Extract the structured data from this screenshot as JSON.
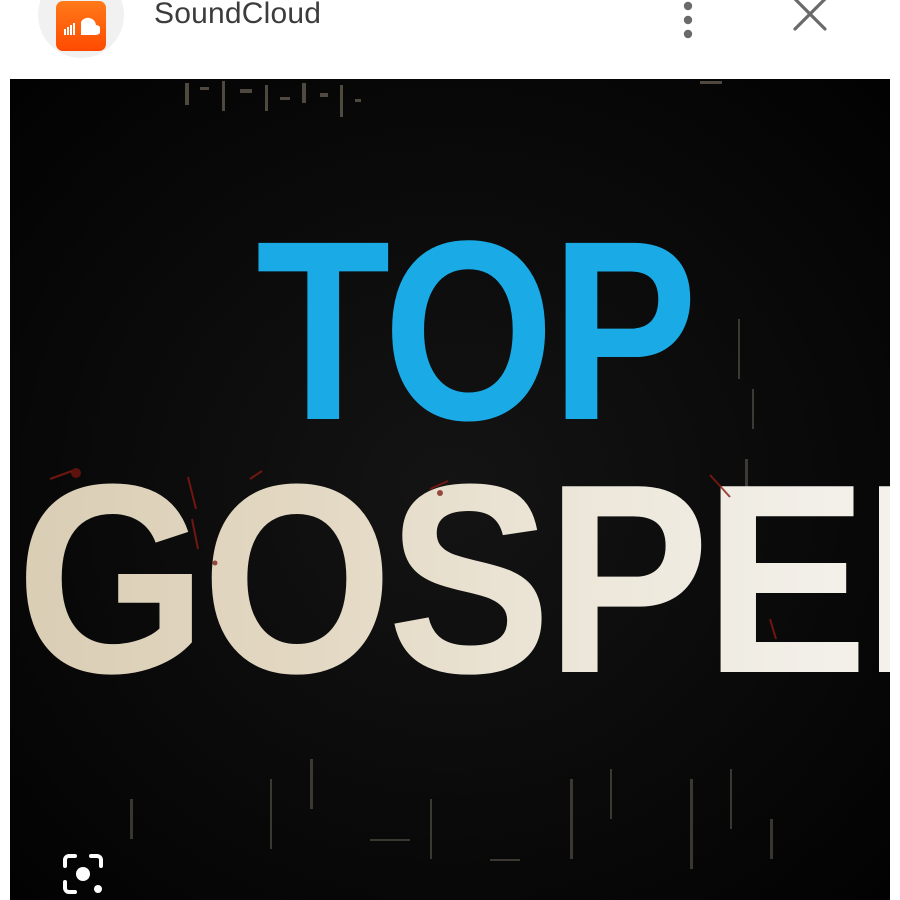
{
  "header": {
    "app_name": "SoundCloud",
    "app_icon": "soundcloud-logo-icon",
    "menu_icon": "more-vertical-icon",
    "close_icon": "close-icon"
  },
  "artwork": {
    "line1": "TOP",
    "line2": "GOSPEL",
    "line1_color": "#1aabe6",
    "line2_color": "#e6dcc8",
    "background_color": "#080808"
  },
  "overlay": {
    "lens_icon": "visual-search-icon"
  },
  "colors": {
    "soundcloud_orange": "#ff5500"
  }
}
